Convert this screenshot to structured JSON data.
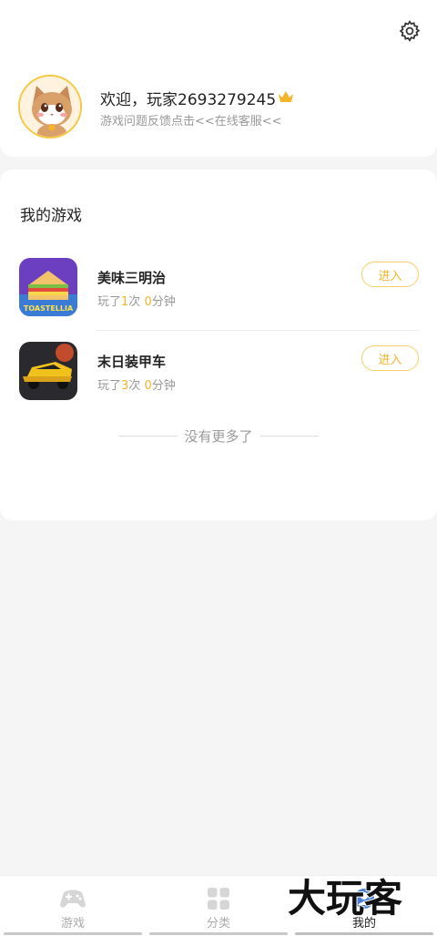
{
  "header": {
    "welcome": "欢迎，玩家2693279245",
    "feedback": "游戏问题反馈点击<<在线客服<<"
  },
  "my_games": {
    "title": "我的游戏",
    "games": [
      {
        "name": "美味三明治",
        "play_prefix": "玩了",
        "count": "1",
        "count_unit": "次",
        "minutes": "0",
        "minutes_unit": "分钟",
        "enter": "进入",
        "icon_text": "TOASTELLIA"
      },
      {
        "name": "末日装甲车",
        "play_prefix": "玩了",
        "count": "3",
        "count_unit": "次",
        "minutes": "0",
        "minutes_unit": "分钟",
        "enter": "进入"
      }
    ],
    "no_more": "没有更多了"
  },
  "tabbar": {
    "tabs": [
      {
        "label": "游戏",
        "icon": "gamepad-icon"
      },
      {
        "label": "分类",
        "icon": "grid-icon"
      },
      {
        "label": "我的",
        "icon": "profile-icon"
      }
    ],
    "active": 2
  },
  "watermark": "大玩客",
  "colors": {
    "accent": "#f5b42a",
    "accent_border": "#f7cf6a",
    "muted": "#999999"
  }
}
